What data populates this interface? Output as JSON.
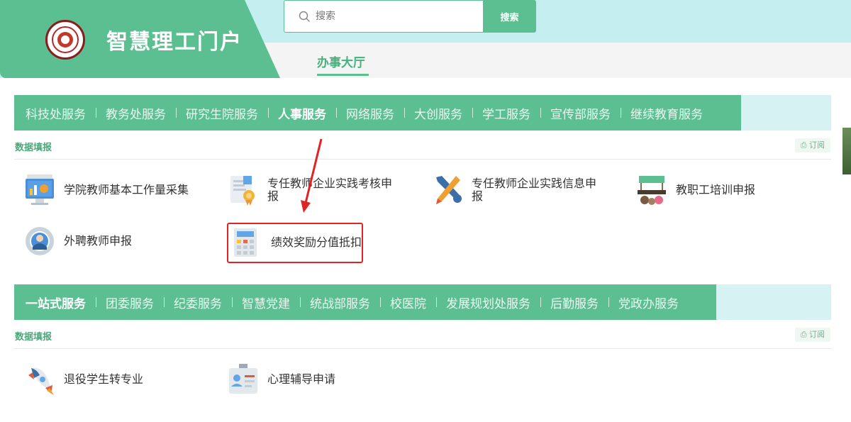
{
  "header": {
    "brand_title": "智慧理工门户",
    "search": {
      "placeholder": "搜索",
      "button_label": "搜索"
    },
    "main_tab": "办事大厅"
  },
  "sections": [
    {
      "tabs": [
        "科技处服务",
        "教务处服务",
        "研究生院服务",
        "人事服务",
        "网络服务",
        "大创服务",
        "学工服务",
        "宣传部服务",
        "继续教育服务"
      ],
      "active_tab": "人事服务",
      "sub_title": "数据填报",
      "subscribe_label": "订阅",
      "items": [
        {
          "label": "学院教师基本工作量采集",
          "icon": "monitor-chart-icon"
        },
        {
          "label": "专任教师企业实践考核申报",
          "icon": "certificate-icon"
        },
        {
          "label": "专任教师企业实践信息申报",
          "icon": "tools-icon"
        },
        {
          "label": "教职工培训申报",
          "icon": "training-board-icon"
        },
        {
          "label": "外聘教师申报",
          "icon": "person-gear-icon"
        },
        {
          "label": "绩效奖励分值抵扣",
          "icon": "calculator-icon"
        }
      ]
    },
    {
      "tabs": [
        "一站式服务",
        "团委服务",
        "纪委服务",
        "智慧党建",
        "统战部服务",
        "校医院",
        "发展规划处服务",
        "后勤服务",
        "党政办服务"
      ],
      "active_tab": "一站式服务",
      "sub_title": "数据填报",
      "subscribe_label": "订阅",
      "items": [
        {
          "label": "退役学生转专业",
          "icon": "rocket-icon"
        },
        {
          "label": "心理辅导申请",
          "icon": "id-badge-icon"
        }
      ]
    }
  ],
  "colors": {
    "accent": "#5cbf91",
    "header_bg": "#c4eef0",
    "highlight": "#e02424"
  }
}
